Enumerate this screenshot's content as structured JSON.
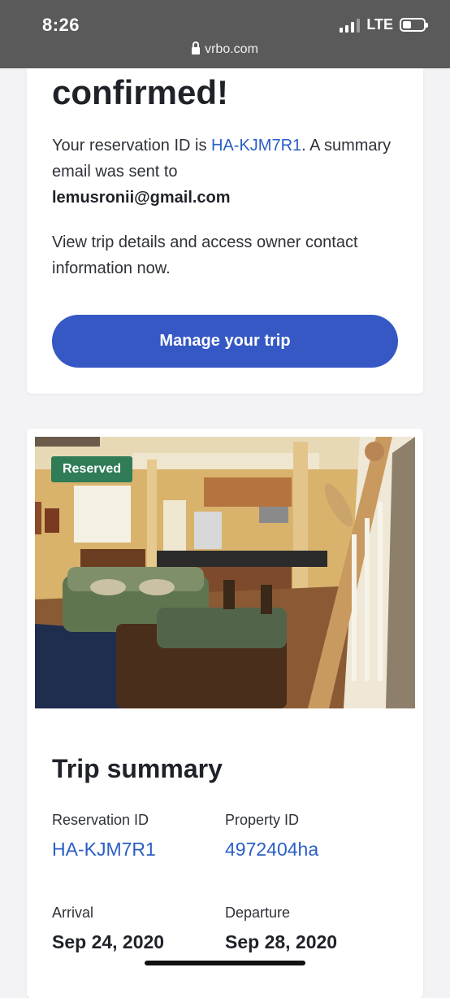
{
  "status_bar": {
    "time": "8:26",
    "network": "LTE",
    "url": "vrbo.com"
  },
  "confirmation": {
    "headline": "confirmed!",
    "reservation_prefix": "Your reservation ID is ",
    "reservation_id": "HA-KJM7R1",
    "summary_suffix": ". A summary email was sent to",
    "email": "lemusronii@gmail.com",
    "details_text": "View trip details and access owner contact information now.",
    "manage_button": "Manage your trip"
  },
  "trip": {
    "badge": "Reserved",
    "title": "Trip summary",
    "reservation_label": "Reservation ID",
    "reservation_value": "HA-KJM7R1",
    "property_label": "Property ID",
    "property_value": "4972404ha",
    "arrival_label": "Arrival",
    "arrival_value": "Sep 24, 2020",
    "departure_label": "Departure",
    "departure_value": "Sep 28, 2020"
  },
  "colors": {
    "brand_blue": "#3558c5",
    "link_blue": "#2b5ec6",
    "reserved_green": "#2f7c57"
  }
}
